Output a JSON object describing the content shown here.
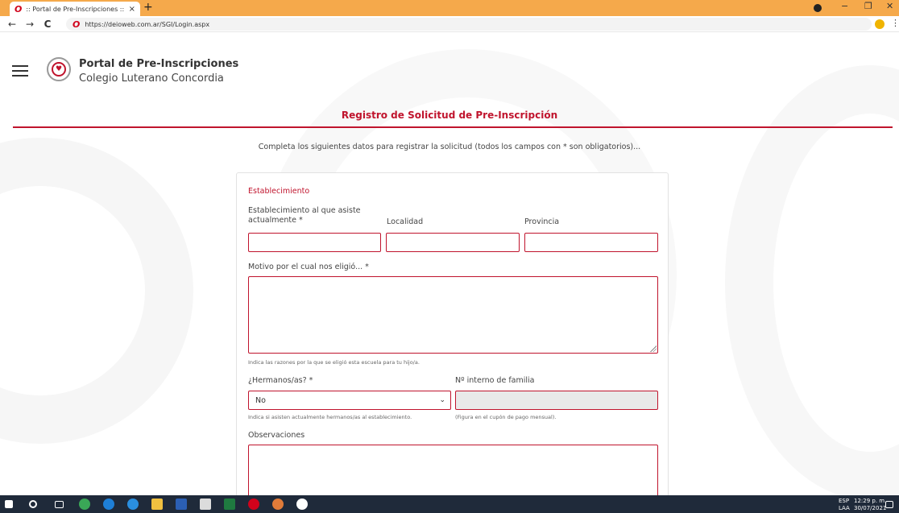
{
  "browser": {
    "tab_title": ":: Portal de Pre-Inscripciones ::",
    "tab_close": "×",
    "new_tab": "+",
    "url": "https://deioweb.com.ar/SGI/Login.aspx",
    "back": "←",
    "forward": "→",
    "reload": "C",
    "menu": "⋮",
    "minimize": "−",
    "restore": "❐",
    "close": "✕"
  },
  "header": {
    "title": "Portal de Pre-Inscripciones",
    "subtitle": "Colegio Luterano Concordia"
  },
  "page": {
    "title": "Registro de Solicitud de Pre-Inscripción",
    "intro": "Completa los siguientes datos para registrar la solicitud (todos los campos con * son obligatorios)..."
  },
  "form": {
    "section": "Establecimiento",
    "establecimiento_label": "Establecimiento al que asiste actualmente *",
    "localidad_label": "Localidad",
    "provincia_label": "Provincia",
    "motivo_label": "Motivo por el cual nos eligió... *",
    "motivo_help": "Indica las razones por la que se eligió esta escuela para tu hijo/a.",
    "hermanos_label": "¿Hermanos/as? *",
    "hermanos_value": "No",
    "hermanos_help": "Indica si asisten actualmente hermanos/as al establecimiento.",
    "nro_familia_label": "Nº interno de familia",
    "nro_familia_help": "(Figura en el cupón de pago mensual).",
    "observaciones_label": "Observaciones"
  },
  "taskbar": {
    "language": "ESP",
    "layout": "LAA",
    "time": "12:29 p. m.",
    "date": "30/07/2021"
  }
}
